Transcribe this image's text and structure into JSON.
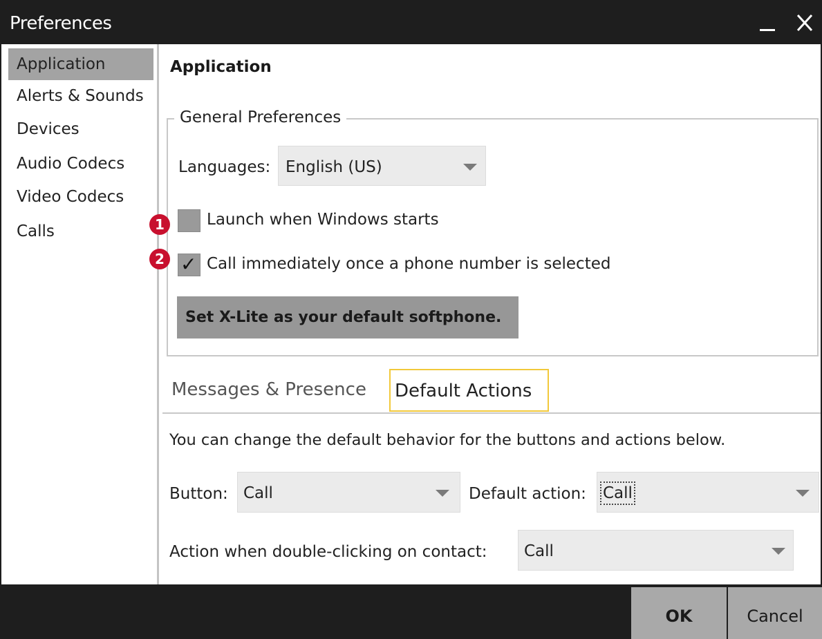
{
  "window": {
    "title": "Preferences"
  },
  "icons": {
    "minimize": "minimize-icon",
    "close": "close-icon",
    "dropdown": "chevron-down-icon",
    "check": "checkmark-icon"
  },
  "sidebar": {
    "items": [
      {
        "label": "Application",
        "selected": true
      },
      {
        "label": "Alerts & Sounds",
        "selected": false
      },
      {
        "label": "Devices",
        "selected": false
      },
      {
        "label": "Audio Codecs",
        "selected": false
      },
      {
        "label": "Video Codecs",
        "selected": false
      },
      {
        "label": "Calls",
        "selected": false
      }
    ]
  },
  "main": {
    "title": "Application",
    "general": {
      "legend": "General Preferences",
      "languages_label": "Languages:",
      "languages_value": "English (US)",
      "launch": {
        "badge": "1",
        "label": "Launch when Windows starts",
        "checked": false
      },
      "call_immediately": {
        "badge": "2",
        "label": "Call immediately once a phone number is selected",
        "checked": true,
        "tick": "✓"
      },
      "default_button": "Set X-Lite as your default softphone."
    },
    "tabs": [
      {
        "label": "Messages & Presence",
        "active": false
      },
      {
        "label": "Default Actions",
        "active": true
      }
    ],
    "default_actions": {
      "description": "You can change the default behavior for the buttons and actions below.",
      "button_label": "Button:",
      "button_value": "Call",
      "default_action_label": "Default action:",
      "default_action_value": "Call",
      "double_click_label": "Action when double-clicking on contact:",
      "double_click_value": "Call"
    }
  },
  "footer": {
    "ok": "OK",
    "cancel": "Cancel"
  },
  "colors": {
    "titlebar": "#1e1e1e",
    "selected_item": "#a3a3a3",
    "tab_focus": "#f2c93a",
    "badge": "#c8102e"
  }
}
